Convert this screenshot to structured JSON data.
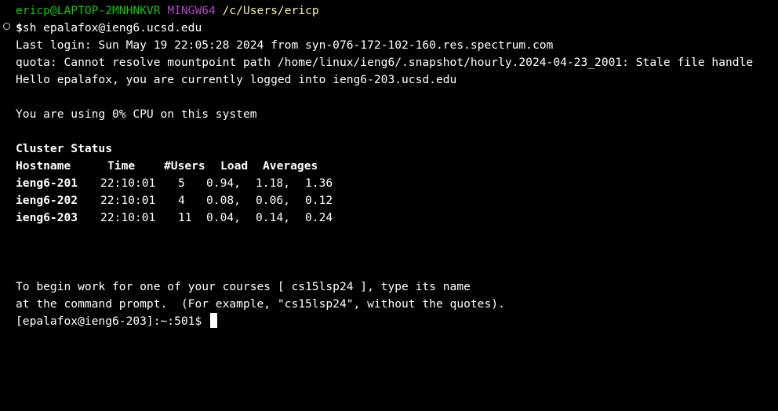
{
  "header": {
    "user_host": "ericp@LAPTOP-2MNHNKVR",
    "shell": "MINGW64",
    "path": "/c/Users/ericp"
  },
  "command": {
    "symbol": "$",
    "text": "ssh epalafox@ieng6.ucsd.edu"
  },
  "output": {
    "last_login": "Last login: Sun May 19 22:05:28 2024 from syn-076-172-102-160.res.spectrum.com",
    "quota": "quota: Cannot resolve mountpoint path /home/linux/ieng6/.snapshot/hourly.2024-04-23_2001: Stale file handle",
    "hello": "Hello epalafox, you are currently logged into ieng6-203.ucsd.edu",
    "cpu": "You are using 0% CPU on this system"
  },
  "cluster": {
    "title": "Cluster Status",
    "headers": {
      "hostname": "Hostname",
      "time": "Time",
      "users": "#Users",
      "load": "Load",
      "averages": "Averages"
    },
    "rows": [
      {
        "host": "ieng6-201",
        "time": "22:10:01",
        "users": "5",
        "a1": "0.94,",
        "a2": "1.18,",
        "a3": "1.36"
      },
      {
        "host": "ieng6-202",
        "time": "22:10:01",
        "users": "4",
        "a1": "0.08,",
        "a2": "0.06,",
        "a3": "0.12"
      },
      {
        "host": "ieng6-203",
        "time": "22:10:01",
        "users": "11",
        "a1": "0.04,",
        "a2": "0.14,",
        "a3": "0.24"
      }
    ]
  },
  "instructions": {
    "line1": "To begin work for one of your courses [ cs15lsp24 ], type its name",
    "line2": "at the command prompt.  (For example, \"cs15lsp24\", without the quotes)."
  },
  "remote_prompt": "[epalafox@ieng6-203]:~:501$",
  "colors": {
    "background": "#000000",
    "user_host": "#16c60c",
    "shell": "#b148c6",
    "path": "#f9f1a5",
    "text": "#ffffff"
  }
}
